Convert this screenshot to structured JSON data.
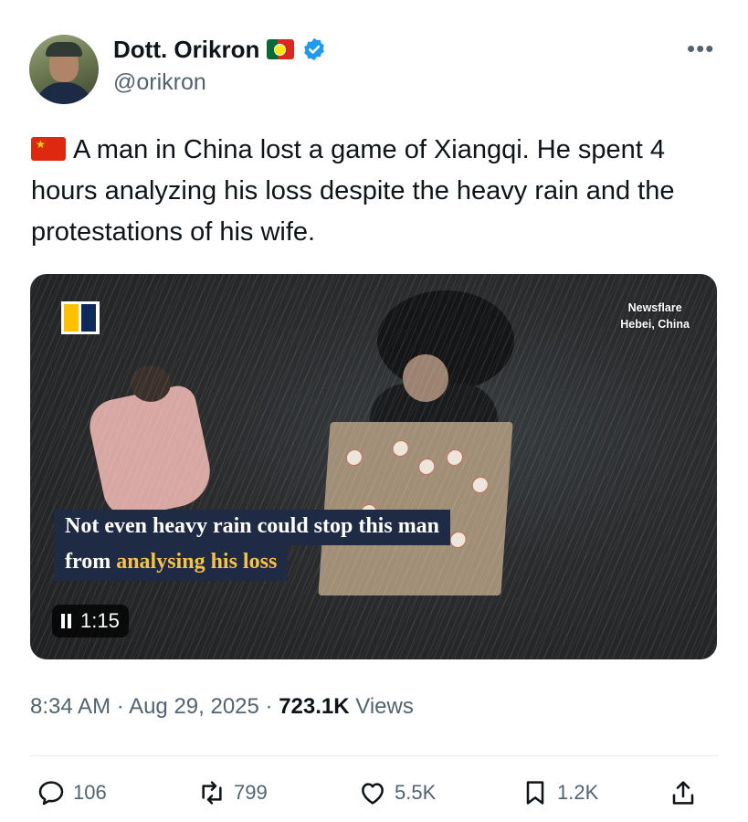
{
  "author": {
    "name": "Dott. Orikron",
    "handle": "@orikron",
    "flag_icon": "portugal-flag-icon",
    "verified_icon": "verified-badge-icon"
  },
  "more_label": "•••",
  "tweet": {
    "flag_icon": "china-flag-icon",
    "text": "A man in China lost a game of Xiangqi. He spent 4 hours analyzing his loss despite the heavy rain and the protestations of his wife."
  },
  "media": {
    "source_line1": "Newsflare",
    "source_line2": "Hebei, China",
    "caption_line1": "Not even heavy rain could stop this man",
    "caption_line2_prefix": "from ",
    "caption_line2_highlight": "analysing his loss",
    "duration": "1:15",
    "highlight_color": "#f6c344"
  },
  "meta": {
    "time": "8:34 AM",
    "separator": " · ",
    "date": "Aug 29, 2025",
    "views_count": "723.1K",
    "views_label": " Views"
  },
  "actions": {
    "replies": "106",
    "reposts": "799",
    "likes": "5.5K",
    "bookmarks": "1.2K"
  }
}
